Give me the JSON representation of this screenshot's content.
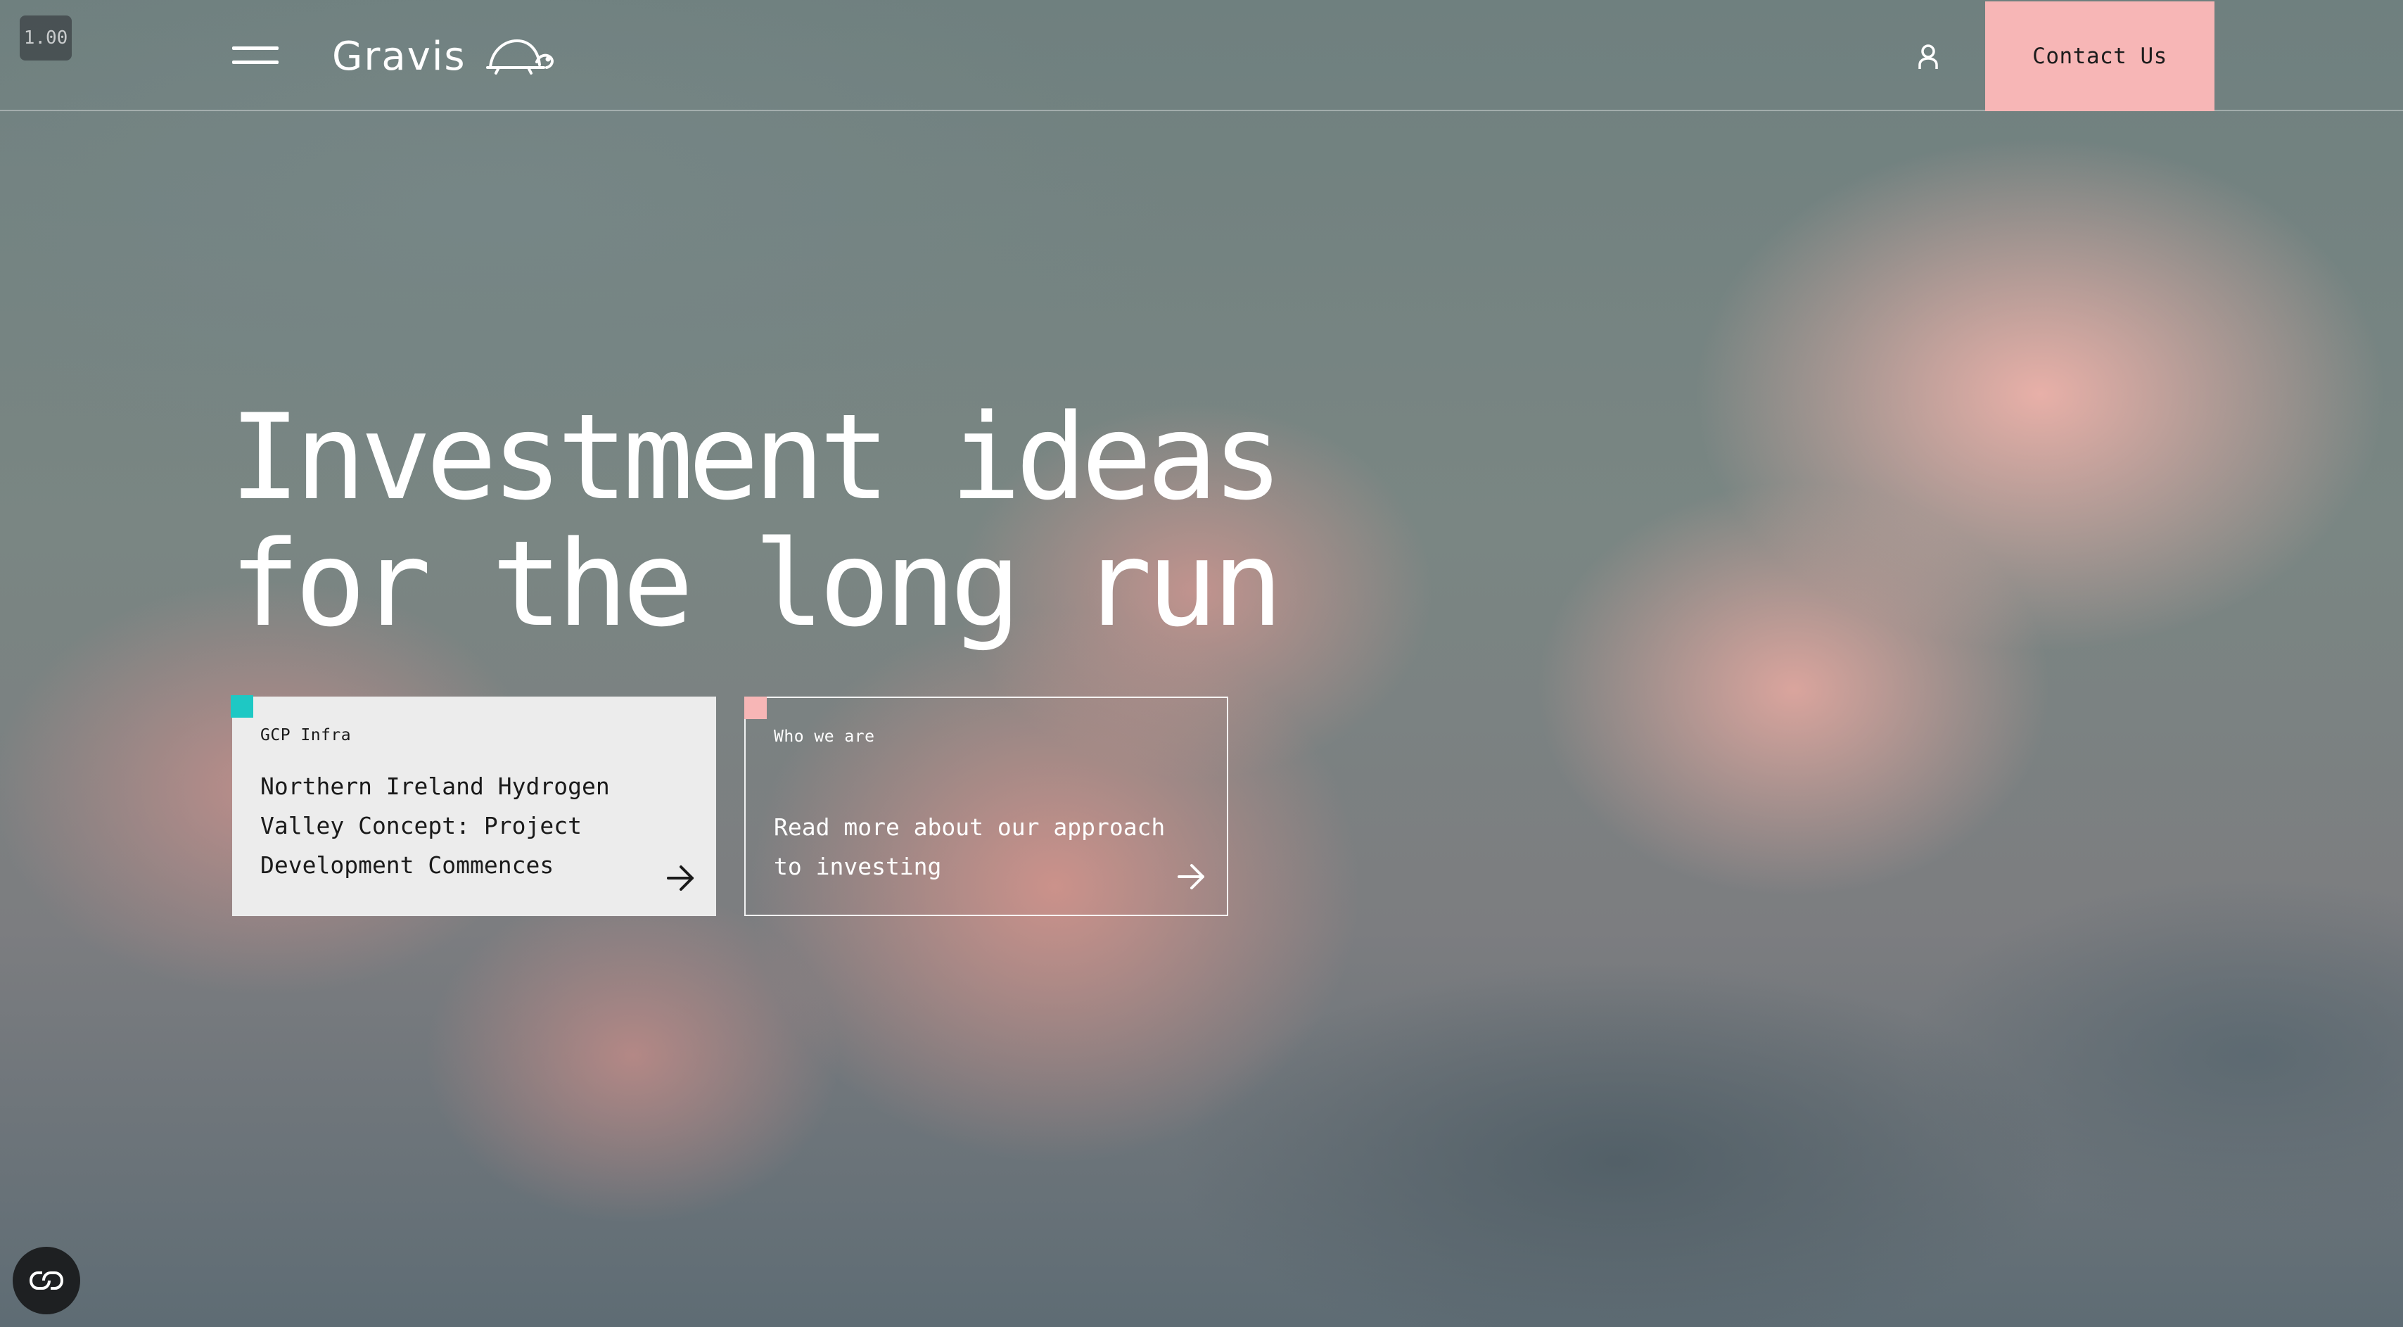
{
  "browser": {
    "zoom": "1.00"
  },
  "header": {
    "brand": "Gravis",
    "logo_icon": "tortoise-icon",
    "menu_icon": "hamburger-menu-icon",
    "account_icon": "user-icon",
    "contact_label": "Contact Us",
    "accent_color": "#f7b6b6"
  },
  "hero": {
    "title_line1": "Investment ideas",
    "title_line2": "for the long run"
  },
  "cards": [
    {
      "tag": "GCP Infra",
      "text": "Northern Ireland Hydrogen Valley Concept: Project Development Commences",
      "marker_color": "#1ec8c4",
      "arrow_icon": "arrow-right-icon"
    },
    {
      "tag": "Who we are",
      "text": "Read more about our approach to investing",
      "marker_color": "#f7b6b6",
      "arrow_icon": "arrow-right-icon"
    }
  ],
  "accessibility": {
    "icon": "accessibility-toggle-icon"
  }
}
